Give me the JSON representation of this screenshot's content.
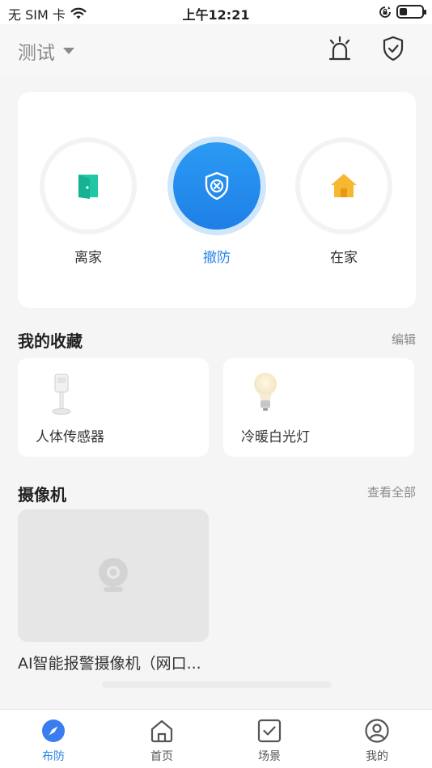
{
  "status_bar": {
    "carrier": "无 SIM 卡",
    "time": "上午12:21",
    "battery_level": 0.35
  },
  "header": {
    "home_name": "测试",
    "icons": [
      "alarm-light-icon",
      "shield-check-icon"
    ]
  },
  "security": {
    "modes": [
      {
        "label": "离家",
        "icon": "door-exit-icon",
        "active": false
      },
      {
        "label": "撤防",
        "icon": "shield-x-icon",
        "active": true
      },
      {
        "label": "在家",
        "icon": "home-icon",
        "active": false
      }
    ]
  },
  "favorites": {
    "title": "我的收藏",
    "edit_label": "编辑",
    "items": [
      {
        "label": "人体传感器",
        "icon": "motion-sensor-icon"
      },
      {
        "label": "冷暖白光灯",
        "icon": "light-bulb-icon"
      }
    ]
  },
  "cameras": {
    "title": "摄像机",
    "view_all_label": "查看全部",
    "items": [
      {
        "label": "AI智能报警摄像机（网口...",
        "icon": "camera-icon"
      }
    ]
  },
  "tab_bar": {
    "tabs": [
      {
        "label": "布防",
        "icon": "compass-icon",
        "active": true
      },
      {
        "label": "首页",
        "icon": "home-outline-icon",
        "active": false
      },
      {
        "label": "场景",
        "icon": "scene-check-icon",
        "active": false
      },
      {
        "label": "我的",
        "icon": "profile-icon",
        "active": false
      }
    ]
  },
  "colors": {
    "accent": "#2a86e8",
    "background": "#f5f5f5",
    "door_green": "#21c7a6",
    "home_yellow": "#f7b732"
  }
}
